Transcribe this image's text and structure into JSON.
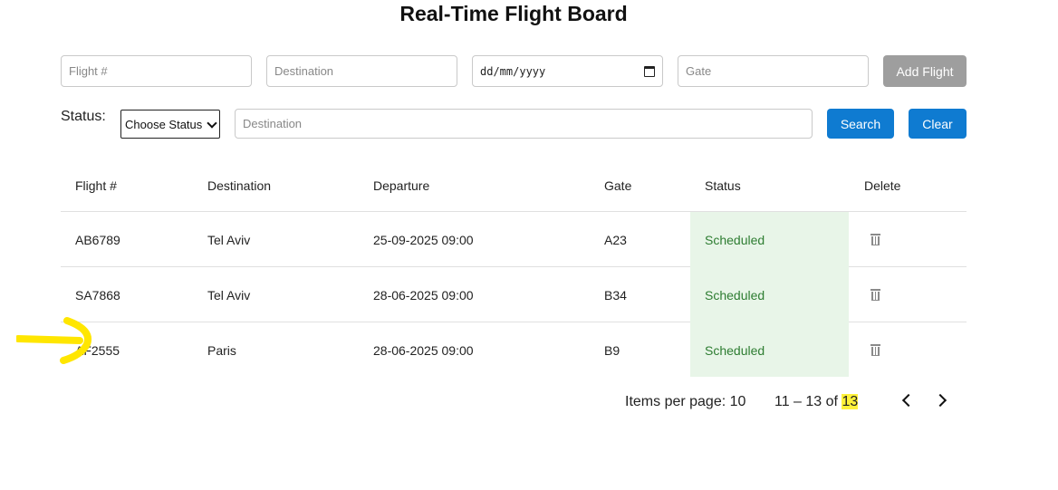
{
  "title": "Real-Time Flight Board",
  "add_form": {
    "flight_placeholder": "Flight #",
    "destination_placeholder": "Destination",
    "date_placeholder": "dd/mm/yyyy",
    "gate_placeholder": "Gate",
    "add_button": "Add Flight"
  },
  "filter": {
    "status_label": "Status:",
    "status_select": "Choose Status",
    "destination_placeholder": "Destination",
    "search_button": "Search",
    "clear_button": "Clear"
  },
  "table": {
    "headers": [
      "Flight #",
      "Destination",
      "Departure",
      "Gate",
      "Status",
      "Delete"
    ],
    "rows": [
      {
        "flight": "AB6789",
        "destination": "Tel Aviv",
        "departure": "25-09-2025 09:00",
        "gate": "A23",
        "status": "Scheduled"
      },
      {
        "flight": "SA7868",
        "destination": "Tel Aviv",
        "departure": "28-06-2025 09:00",
        "gate": "B34",
        "status": "Scheduled"
      },
      {
        "flight": "AF2555",
        "destination": "Paris",
        "departure": "28-06-2025 09:00",
        "gate": "B9",
        "status": "Scheduled"
      }
    ]
  },
  "pagination": {
    "items_per_page_label": "Items per page:",
    "items_per_page": "10",
    "range": "11 – 13 of",
    "total": "13"
  },
  "colors": {
    "primary": "#0f7bd1",
    "disabled": "#9e9e9e",
    "status_bg": "#e8f5e8",
    "status_text": "#2e7d32",
    "annotation": "#ffe600"
  },
  "icons": [
    "calendar-icon",
    "chevron-down-icon",
    "trash-icon",
    "chevron-left-icon",
    "chevron-right-icon"
  ]
}
